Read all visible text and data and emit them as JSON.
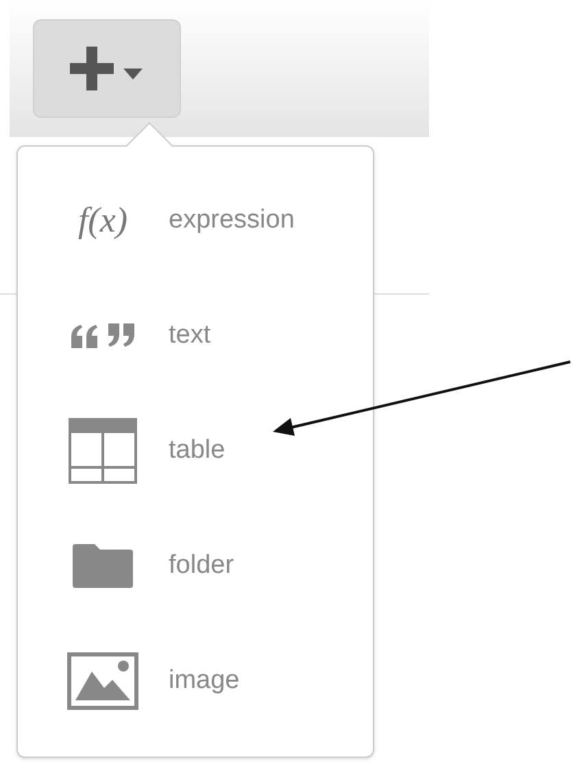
{
  "toolbar": {
    "add_button": {
      "expanded": true
    }
  },
  "menu": {
    "items": [
      {
        "kind": "formula",
        "glyph": "f(x)",
        "label": "expression"
      },
      {
        "kind": "quote",
        "label": "text"
      },
      {
        "kind": "table",
        "label": "table"
      },
      {
        "kind": "folder",
        "label": "folder"
      },
      {
        "kind": "image",
        "label": "image"
      }
    ]
  }
}
